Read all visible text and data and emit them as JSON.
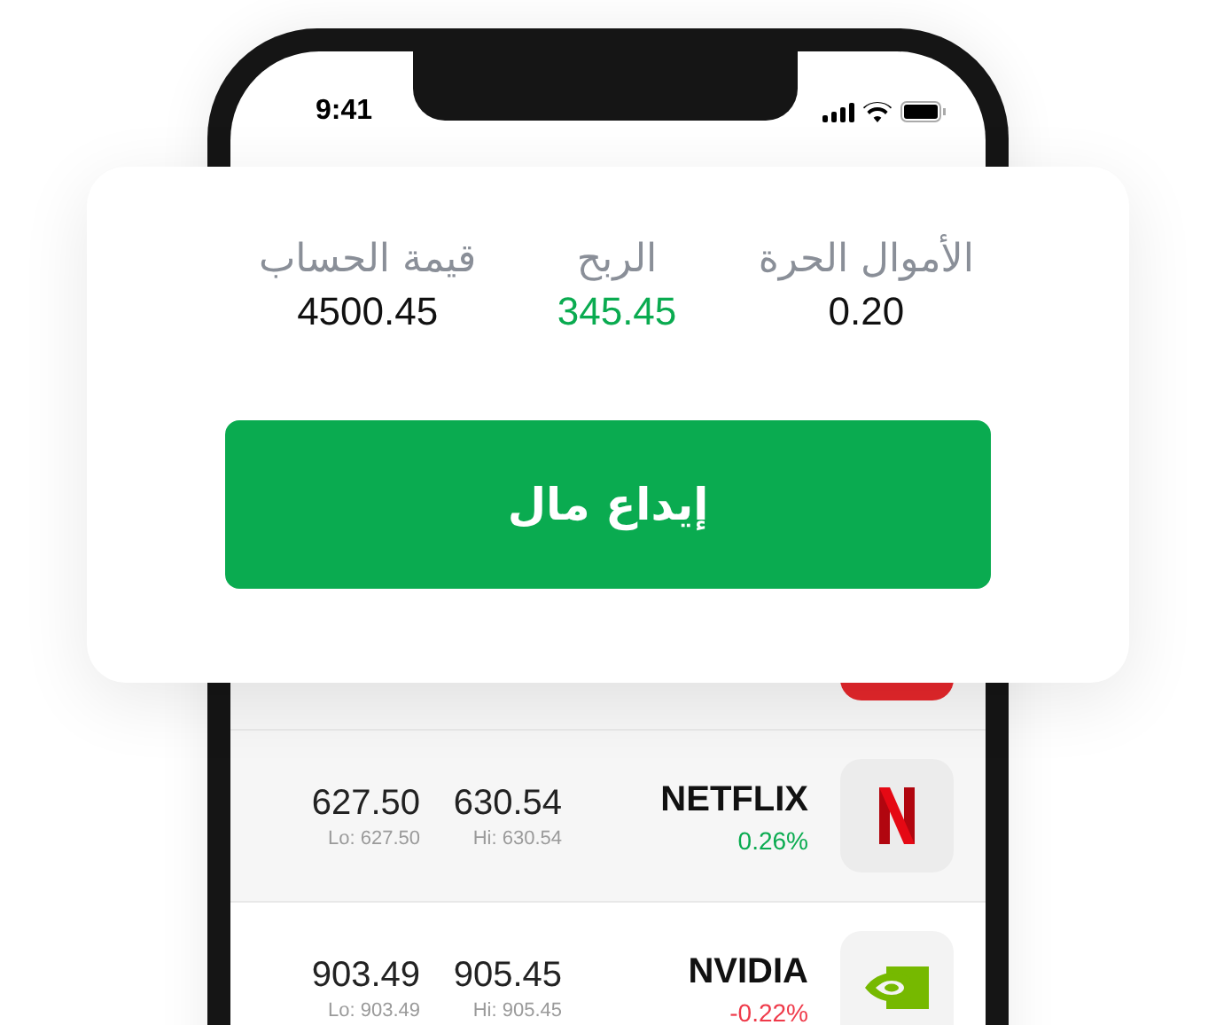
{
  "status_bar": {
    "time": "9:41"
  },
  "summary": {
    "account_value": {
      "label": "قيمة الحساب",
      "value": "4500.45",
      "color": "#111111"
    },
    "profit": {
      "label": "الربح",
      "value": "345.45",
      "color": "#0aab50"
    },
    "free_funds": {
      "label": "الأموال الحرة",
      "value": "0.20",
      "color": "#111111"
    },
    "deposit_button": "إيداع مال"
  },
  "stocks": [
    {
      "kind": "red-tile"
    },
    {
      "kind": "netflix",
      "name": "NETFLIX",
      "change": "0.26%",
      "color": "#0aab50",
      "high": "630.54",
      "high_label": "Hi: 630.54",
      "low": "627.50",
      "low_label": "Lo: 627.50"
    },
    {
      "kind": "nvidia",
      "name": "NVIDIA",
      "change": "-0.22%",
      "color": "#ef3a4a",
      "high": "905.45",
      "high_label": "Hi: 905.45",
      "low": "903.49",
      "low_label": "Lo: 903.49"
    }
  ]
}
